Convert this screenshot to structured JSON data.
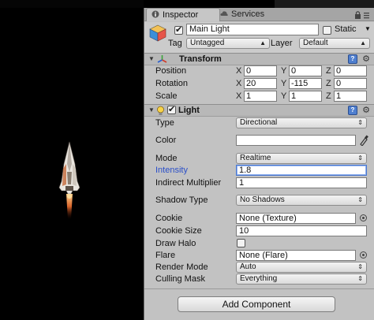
{
  "tabs": {
    "inspector": "Inspector",
    "services": "Services"
  },
  "game_object": {
    "active": true,
    "name": "Main Light",
    "static_label": "Static",
    "static_checked": false,
    "tag_label": "Tag",
    "tag_value": "Untagged",
    "layer_label": "Layer",
    "layer_value": "Default"
  },
  "transform": {
    "title": "Transform",
    "position": {
      "label": "Position",
      "x": "0",
      "y": "0",
      "z": "0"
    },
    "rotation": {
      "label": "Rotation",
      "x": "20",
      "y": "-115",
      "z": "0"
    },
    "scale": {
      "label": "Scale",
      "x": "1",
      "y": "1",
      "z": "1"
    },
    "axis": {
      "x": "X",
      "y": "Y",
      "z": "Z"
    }
  },
  "light": {
    "title": "Light",
    "enabled": true,
    "type": {
      "label": "Type",
      "value": "Directional"
    },
    "color": {
      "label": "Color",
      "value": "#ffffff"
    },
    "mode": {
      "label": "Mode",
      "value": "Realtime"
    },
    "intensity": {
      "label": "Intensity",
      "value": "1.8"
    },
    "indirect": {
      "label": "Indirect Multiplier",
      "value": "1"
    },
    "shadow": {
      "label": "Shadow Type",
      "value": "No Shadows"
    },
    "cookie": {
      "label": "Cookie",
      "value": "None (Texture)"
    },
    "cookie_size": {
      "label": "Cookie Size",
      "value": "10"
    },
    "draw_halo": {
      "label": "Draw Halo",
      "checked": false
    },
    "flare": {
      "label": "Flare",
      "value": "None (Flare)"
    },
    "render_mode": {
      "label": "Render Mode",
      "value": "Auto"
    },
    "culling_mask": {
      "label": "Culling Mask",
      "value": "Everything"
    }
  },
  "add_component": "Add Component"
}
